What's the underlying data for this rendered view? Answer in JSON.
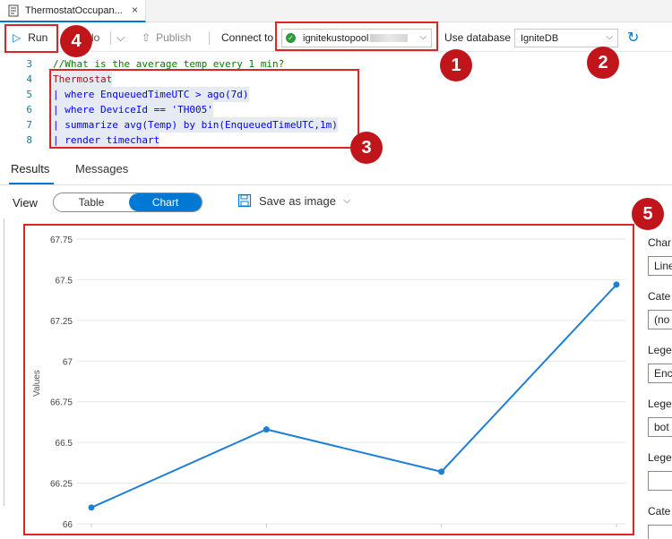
{
  "document_tab": {
    "label": "ThermostatOccupan...",
    "close_glyph": "×",
    "icon": "query-document-icon"
  },
  "toolbar": {
    "run_label": "Run",
    "run_icon": "play-icon",
    "redo_label": "do",
    "publish_label": "Publish",
    "connect_to_label": "Connect to",
    "cluster_value": "ignitekustopool",
    "use_database_label": "Use database",
    "database_value": "IgniteDB",
    "refresh_icon": "refresh-icon"
  },
  "editor": {
    "lines": [
      {
        "number": "3",
        "text": "//What is the average temp every 1 min?"
      },
      {
        "number": "4",
        "text": "Thermostat"
      },
      {
        "number": "5",
        "text": "| where EnqueuedTimeUTC > ago(7d)"
      },
      {
        "number": "6",
        "text": "| where DeviceId == 'TH005'"
      },
      {
        "number": "7",
        "text": "| summarize avg(Temp) by bin(EnqueuedTimeUTC,1m)"
      },
      {
        "number": "8",
        "text": "| render timechart"
      }
    ]
  },
  "results": {
    "tabs": [
      "Results",
      "Messages"
    ],
    "active_tab": "Results",
    "view_label": "View",
    "view_options": [
      "Table",
      "Chart"
    ],
    "active_view": "Chart",
    "save_as_image_label": "Save as image"
  },
  "side_panel": {
    "labels": [
      "Char",
      "Cate",
      "Lege",
      "Lege",
      "Lege",
      "Cate"
    ],
    "fields": [
      "Line",
      "(no",
      "Enc",
      "bot",
      "",
      ""
    ]
  },
  "chart_data": {
    "type": "line",
    "ylabel": "Values",
    "ylim": [
      66,
      67.75
    ],
    "yticks": [
      "67.75",
      "67.5",
      "67.25",
      "67",
      "66.75",
      "66.5",
      "66.25",
      "66"
    ],
    "series": [
      {
        "values": [
          66.1,
          66.58,
          66.32,
          67.47
        ]
      }
    ],
    "line_color": "#1f7fd6",
    "grid": true
  },
  "annotations": [
    {
      "number": "1",
      "target": "connect-to-cluster"
    },
    {
      "number": "2",
      "target": "use-database"
    },
    {
      "number": "3",
      "target": "query-text"
    },
    {
      "number": "4",
      "target": "run-button"
    },
    {
      "number": "5",
      "target": "chart-result"
    }
  ],
  "colors": {
    "accent": "#0078d4",
    "callout_border": "#e02424",
    "badge_fill": "#c0161b"
  }
}
